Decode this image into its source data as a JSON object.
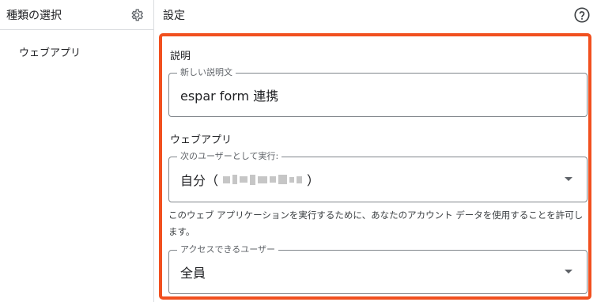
{
  "sidebar": {
    "title": "種類の選択",
    "items": [
      {
        "label": "ウェブアプリ"
      }
    ]
  },
  "header": {
    "title": "設定"
  },
  "description_section": {
    "label": "説明",
    "field_label": "新しい説明文",
    "value": "espar form 連携"
  },
  "webapp_section": {
    "label": "ウェブアプリ",
    "execute_as": {
      "label": "次のユーザーとして実行:",
      "value_prefix": "自分（",
      "value_suffix": "）"
    },
    "help_text": "このウェブ アプリケーションを実行するために、あなたのアカウント データを使用することを許可します。",
    "access": {
      "label": "アクセスできるユーザー",
      "value": "全員"
    }
  },
  "colors": {
    "highlight": "#f1501f",
    "border": "#dadce0"
  },
  "icons": [
    "gear-icon",
    "help-icon",
    "dropdown-caret-icon"
  ]
}
